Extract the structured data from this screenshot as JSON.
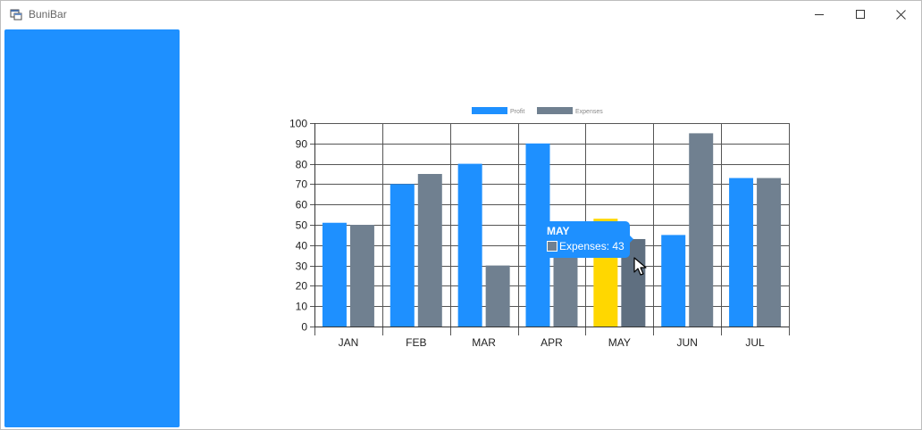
{
  "window": {
    "title": "BuniBar",
    "icons": {
      "app": "app-window-icon",
      "minimize": "minimize-icon",
      "maximize": "maximize-icon",
      "close": "close-icon",
      "cursor": "mouse-pointer-icon"
    }
  },
  "colors": {
    "side_panel": "#1e90ff",
    "profit": "#1e90ff",
    "expenses": "#708090",
    "highlight": "#ffd700",
    "tooltip_bg": "#1e90ff",
    "grid": "#555555"
  },
  "tooltip": {
    "title": "MAY",
    "series": "Expenses",
    "value": "43",
    "text": "Expenses: 43"
  },
  "chart_data": {
    "type": "bar",
    "categories": [
      "JAN",
      "FEB",
      "MAR",
      "APR",
      "MAY",
      "JUN",
      "JUL"
    ],
    "series": [
      {
        "name": "Profit",
        "values": [
          51,
          70,
          80,
          90,
          53,
          45,
          73
        ]
      },
      {
        "name": "Expenses",
        "values": [
          50,
          75,
          30,
          40,
          43,
          95,
          73
        ]
      }
    ],
    "highlighted": {
      "category": "MAY",
      "series": "Profit"
    },
    "hovered": {
      "category": "MAY",
      "series": "Expenses"
    },
    "ylim": [
      0,
      100
    ],
    "yticks": [
      "0",
      "10",
      "20",
      "30",
      "40",
      "50",
      "60",
      "70",
      "80",
      "90",
      "100"
    ],
    "grid": true,
    "legend": "top-center",
    "title": "",
    "xlabel": "",
    "ylabel": ""
  }
}
